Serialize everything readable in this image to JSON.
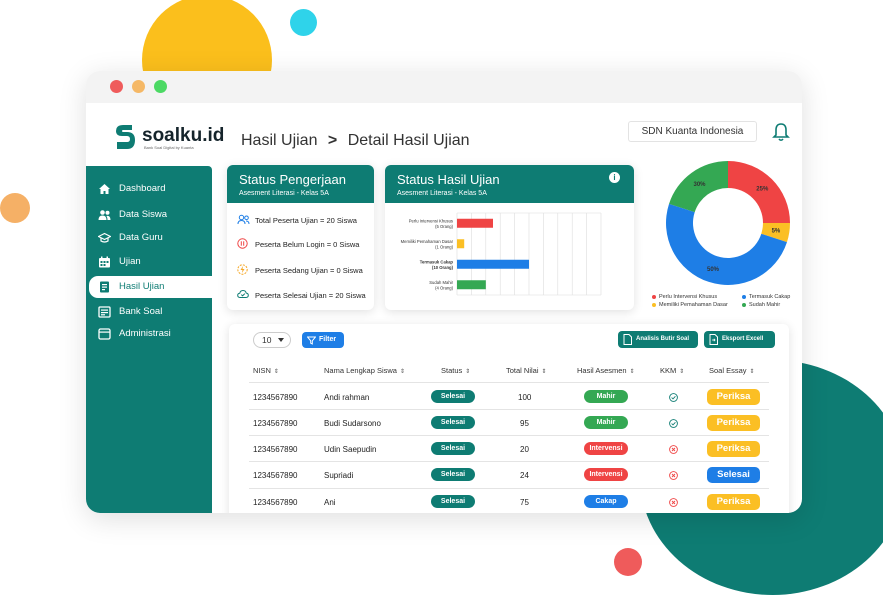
{
  "brand": {
    "name": "soalku.id",
    "tagline": "Bank Soal Digital by Kuanta",
    "color": "#0e7c73"
  },
  "header": {
    "breadcrumb_parent": "Hasil Ujian",
    "breadcrumb_sep": ">",
    "breadcrumb_current": "Detail Hasil Ujian",
    "school": "SDN Kuanta Indonesia"
  },
  "sidebar": {
    "items": [
      {
        "label": "Dashboard",
        "icon": "home-icon",
        "active": false
      },
      {
        "label": "Data Siswa",
        "icon": "users-icon",
        "active": false
      },
      {
        "label": "Data Guru",
        "icon": "graduation-cap-icon",
        "active": false
      },
      {
        "label": "Ujian",
        "icon": "calendar-icon",
        "active": false
      },
      {
        "label": "Hasil Ujian",
        "icon": "document-icon",
        "active": true
      },
      {
        "label": "Bank Soal",
        "icon": "book-icon",
        "active": false
      },
      {
        "label": "Administrasi",
        "icon": "folder-icon",
        "active": false
      }
    ]
  },
  "status_pengerjaan": {
    "title": "Status Pengerjaan",
    "subtitle": "Asesment Literasi - Kelas 5A",
    "rows": [
      {
        "label": "Total Peserta Ujian = 20 Siswa",
        "icon": "users-icon"
      },
      {
        "label": "Peserta Belum Login = 0 Siswa",
        "icon": "pause-icon"
      },
      {
        "label": "Peserta Sedang Ujian = 0 Siswa",
        "icon": "bolt-icon"
      },
      {
        "label": "Peserta Selesai Ujian = 20 Siswa",
        "icon": "cloud-check-icon"
      }
    ]
  },
  "status_hasil": {
    "title": "Status Hasil Ujian",
    "subtitle": "Asesment Literasi - Kelas 5A",
    "info_icon": "i"
  },
  "chart_data": [
    {
      "type": "bar",
      "orientation": "horizontal",
      "categories": [
        "Perlu Intervensi Khusus (5 Orang)",
        "Memiliki Pemahaman Dasar (1 Orang)",
        "Termasuk Cakap (10 Orang)",
        "Sudah Mahir (4 Orang)"
      ],
      "category_lines": [
        [
          "Perlu Intervensi Khusus",
          "(5 Orang)"
        ],
        [
          "Memiliki Pemahaman Dasar",
          "(1 Orang)"
        ],
        [
          "Termasuk Cakap",
          "(10 Orang)"
        ],
        [
          "Sudah Mahir",
          "(4 Orang)"
        ]
      ],
      "values": [
        5,
        1,
        10,
        4
      ],
      "colors": [
        "#ef4444",
        "#fbbf24",
        "#1e7ee6",
        "#34a853"
      ],
      "highlighted": 2,
      "xlim": [
        0,
        20
      ],
      "grid": true
    },
    {
      "type": "pie",
      "donut": true,
      "labels": [
        "Perlu Intervensi Khusus",
        "Memiliki Pemahaman Dasar",
        "Termasuk Cakap",
        "Sudah Mahir"
      ],
      "values": [
        25,
        5,
        50,
        20
      ],
      "value_labels": [
        "25%",
        "5%",
        "50%",
        "30%"
      ],
      "colors": [
        "#ef4444",
        "#fbbf24",
        "#1e7ee6",
        "#34a853"
      ],
      "legend_order": [
        0,
        2,
        1,
        3
      ]
    }
  ],
  "table": {
    "page_size": "10",
    "filter_label": "Filter",
    "analisis_label": "Analisis Butir Soal",
    "export_label": "Eksport Excell",
    "columns": [
      "NISN",
      "Nama Lengkap Siswa",
      "Status",
      "Total Nilai",
      "Hasil Asesmen",
      "KKM",
      "Soal Essay"
    ],
    "rows": [
      {
        "nisn": "1234567890",
        "name": "Andi rahman",
        "status": "Selesai",
        "score": "100",
        "result": "Mahir",
        "kkm": "pass",
        "essay": "Periksa"
      },
      {
        "nisn": "1234567890",
        "name": "Budi Sudarsono",
        "status": "Selesai",
        "score": "95",
        "result": "Mahir",
        "kkm": "pass",
        "essay": "Periksa"
      },
      {
        "nisn": "1234567890",
        "name": "Udin Saepudin",
        "status": "Selesai",
        "score": "20",
        "result": "Intervensi",
        "kkm": "fail",
        "essay": "Periksa"
      },
      {
        "nisn": "1234567890",
        "name": "Supriadi",
        "status": "Selesai",
        "score": "24",
        "result": "Intervensi",
        "kkm": "fail",
        "essay": "Selesai"
      },
      {
        "nisn": "1234567890",
        "name": "Ani",
        "status": "Selesai",
        "score": "75",
        "result": "Cakap",
        "kkm": "fail",
        "essay": "Periksa"
      }
    ]
  },
  "colors": {
    "mahir": "#34a853",
    "intervensi": "#ef4444",
    "cakap": "#1e7ee6",
    "periksa": "#fbbf24",
    "selesai_essay": "#1e7ee6",
    "status_pill": "#0e7c73"
  }
}
